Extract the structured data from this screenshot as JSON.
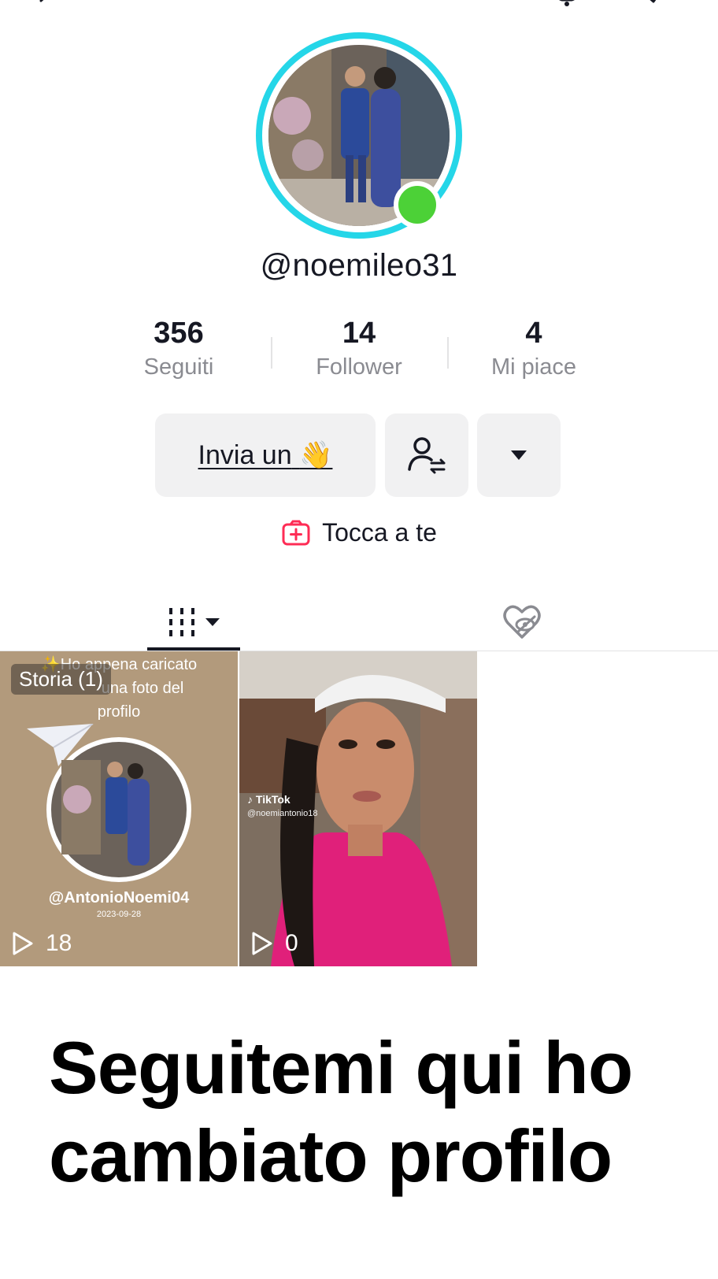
{
  "profile": {
    "username": "@noemileo31",
    "online": true
  },
  "stats": [
    {
      "value": "356",
      "label": "Seguiti"
    },
    {
      "value": "14",
      "label": "Follower"
    },
    {
      "value": "4",
      "label": "Mi piace"
    }
  ],
  "actions": {
    "wave_label": "Invia un",
    "wave_emoji": "👋",
    "friends_icon": "person-switch-icon",
    "more_icon": "caret-down-icon"
  },
  "tocca": {
    "label": "Tocca a te",
    "icon": "add-story-icon",
    "icon_color": "#fe2c55"
  },
  "tabs": [
    {
      "name": "videos",
      "icon": "grid-icon",
      "active": true
    },
    {
      "name": "liked",
      "icon": "heart-hidden-icon",
      "active": false
    }
  ],
  "videos": [
    {
      "badge": "Storia (1)",
      "caption": "✨Ho appena caricato una foto del profilo",
      "caption_visible": "✨Ho appena caricato",
      "caption_line2": "una foto del",
      "caption_line3": "profilo",
      "handle": "@AntonioNoemi04",
      "date": "2023-09-28",
      "views": "18"
    },
    {
      "watermark_brand": "TikTok",
      "watermark_handle": "@noemiantonio18",
      "views": "0"
    }
  ],
  "overlay": {
    "line1": "Seguitemi qui ho",
    "line2": "cambiato profilo"
  },
  "colors": {
    "ring": "#25d6e8",
    "online": "#4cd137",
    "button_bg": "#f1f1f2",
    "accent": "#fe2c55"
  }
}
